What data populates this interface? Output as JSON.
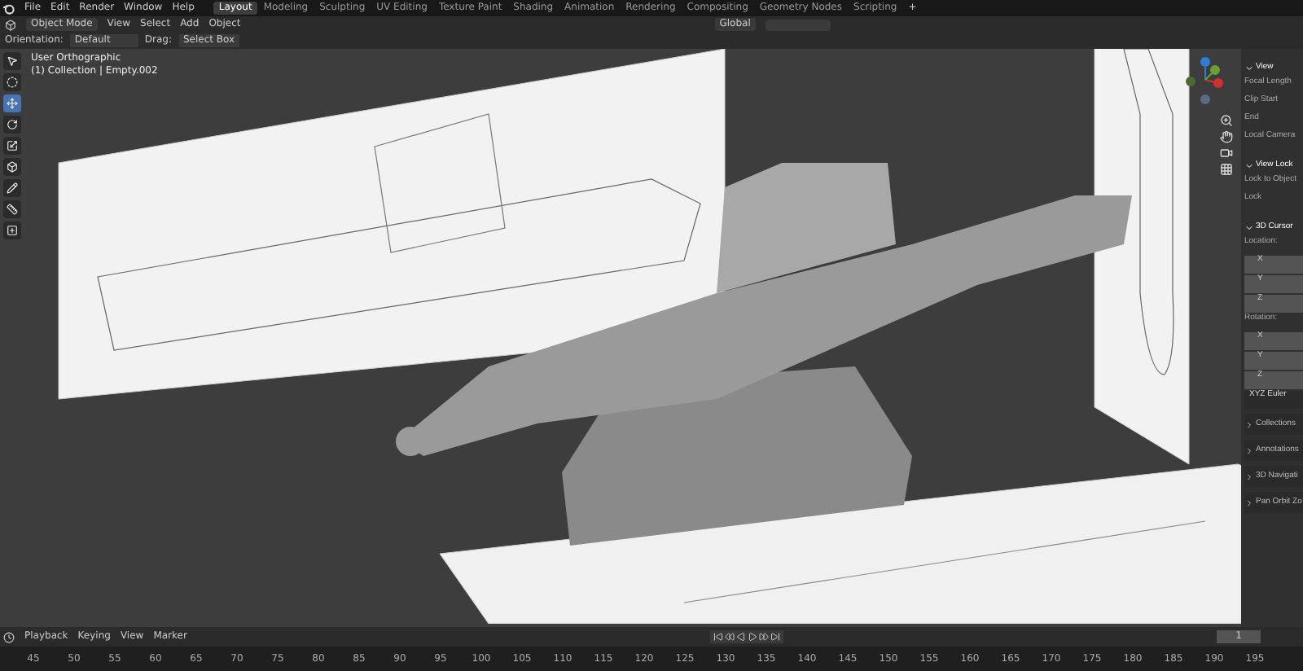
{
  "menu": [
    "File",
    "Edit",
    "Render",
    "Window",
    "Help"
  ],
  "workspaces": [
    {
      "label": "Layout",
      "selected": true
    },
    {
      "label": "Modeling",
      "selected": false
    },
    {
      "label": "Sculpting",
      "selected": false
    },
    {
      "label": "UV Editing",
      "selected": false
    },
    {
      "label": "Texture Paint",
      "selected": false
    },
    {
      "label": "Shading",
      "selected": false
    },
    {
      "label": "Animation",
      "selected": false
    },
    {
      "label": "Rendering",
      "selected": false
    },
    {
      "label": "Compositing",
      "selected": false
    },
    {
      "label": "Geometry Nodes",
      "selected": false
    },
    {
      "label": "Scripting",
      "selected": false
    }
  ],
  "add_workspace": "+",
  "header": {
    "mode": "Object Mode",
    "menus": [
      "View",
      "Select",
      "Add",
      "Object"
    ],
    "transform_orientation": "Global"
  },
  "tool_settings": {
    "orientation_label": "Orientation:",
    "orientation": "Default",
    "drag_label": "Drag:",
    "drag": "Select Box"
  },
  "toolbar": [
    {
      "kind": "select",
      "selected": false
    },
    {
      "kind": "cursor",
      "selected": false
    },
    {
      "kind": "move",
      "selected": true
    },
    {
      "kind": "rotate",
      "selected": false
    },
    {
      "kind": "scale",
      "selected": false
    },
    {
      "kind": "transform",
      "selected": false
    },
    {
      "kind": "annotate",
      "selected": false
    },
    {
      "kind": "measure",
      "selected": false
    },
    {
      "kind": "add",
      "selected": false
    }
  ],
  "viewport": {
    "view_name": "User Orthographic",
    "context": "(1) Collection | Empty.002"
  },
  "sidebar": {
    "items": [
      {
        "kind": "panel",
        "text": "View",
        "expanded": true
      },
      {
        "kind": "label",
        "text": "Focal Length"
      },
      {
        "kind": "label",
        "text": "Clip Start"
      },
      {
        "kind": "label",
        "text": "End"
      },
      {
        "kind": "label",
        "text": "Local Camera"
      },
      {
        "kind": "panel",
        "text": "View Lock",
        "expanded": true
      },
      {
        "kind": "label",
        "text": "Lock to Object"
      },
      {
        "kind": "label",
        "text": "Lock"
      },
      {
        "kind": "panel",
        "text": "3D Cursor",
        "expanded": true
      },
      {
        "kind": "label",
        "text": "Location:"
      },
      {
        "kind": "field",
        "text": "X"
      },
      {
        "kind": "field",
        "text": "Y"
      },
      {
        "kind": "field",
        "text": "Z"
      },
      {
        "kind": "label",
        "text": "Rotation:"
      },
      {
        "kind": "field",
        "text": "X"
      },
      {
        "kind": "field",
        "text": "Y"
      },
      {
        "kind": "field",
        "text": "Z"
      },
      {
        "kind": "dropdown",
        "text": "XYZ Euler"
      },
      {
        "kind": "panel",
        "text": "Collections",
        "expanded": false
      },
      {
        "kind": "panel",
        "text": "Annotations",
        "expanded": false
      },
      {
        "kind": "panel",
        "text": "3D Navigati",
        "expanded": false
      },
      {
        "kind": "panel",
        "text": "Pan Orbit Zo",
        "expanded": false
      }
    ]
  },
  "timeline": {
    "menus": [
      "Playback",
      "Keying",
      "View",
      "Marker"
    ],
    "current_frame": "1",
    "ruler": [
      "45",
      "50",
      "55",
      "60",
      "65",
      "70",
      "75",
      "80",
      "85",
      "90",
      "95",
      "100",
      "105",
      "110",
      "115",
      "120",
      "125",
      "130",
      "135",
      "140",
      "145",
      "150",
      "155",
      "160",
      "165",
      "170",
      "175",
      "180",
      "185",
      "190",
      "195"
    ]
  }
}
